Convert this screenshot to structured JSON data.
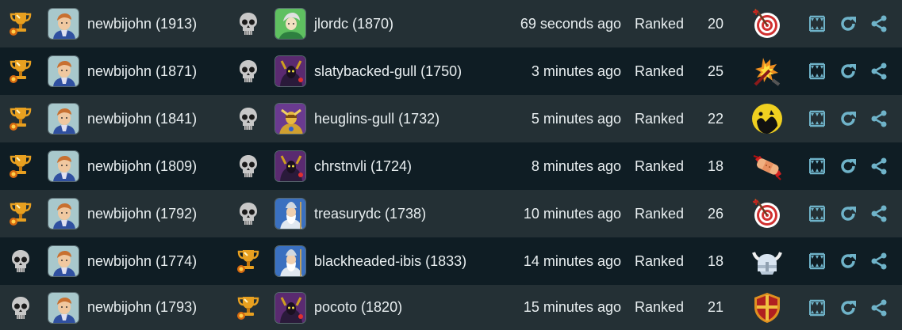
{
  "colors": {
    "row_odd": "#243035",
    "row_even": "#0f1d24",
    "text": "#e8eef0",
    "action_icon": "#6fb3c9",
    "trophy": "#e8a020",
    "skull": "#c8c8c8"
  },
  "games": [
    {
      "p1_result": "trophy-icon",
      "p1_name": "newbijohn (1913)",
      "p1_avatar": "portrait-avatar",
      "p2_result": "skull-icon",
      "p2_name": "jlordc (1870)",
      "p2_avatar": "green-elf-avatar",
      "time": "69 seconds ago",
      "mode": "Ranked",
      "turns": "20",
      "map_icon": "target-icon"
    },
    {
      "p1_result": "trophy-icon",
      "p1_name": "newbijohn (1871)",
      "p1_avatar": "portrait-avatar",
      "p2_result": "skull-icon",
      "p2_name": "slatybacked-gull (1750)",
      "p2_avatar": "dark-mage-avatar",
      "time": "3 minutes ago",
      "mode": "Ranked",
      "turns": "25",
      "map_icon": "explosion-icon"
    },
    {
      "p1_result": "trophy-icon",
      "p1_name": "newbijohn (1841)",
      "p1_avatar": "portrait-avatar",
      "p2_result": "skull-icon",
      "p2_name": "heuglins-gull (1732)",
      "p2_avatar": "golden-knight-avatar",
      "time": "5 minutes ago",
      "mode": "Ranked",
      "turns": "22",
      "map_icon": "moon-battle-icon"
    },
    {
      "p1_result": "trophy-icon",
      "p1_name": "newbijohn (1809)",
      "p1_avatar": "portrait-avatar",
      "p2_result": "skull-icon",
      "p2_name": "chrstnvli (1724)",
      "p2_avatar": "dark-mage-avatar",
      "time": "8 minutes ago",
      "mode": "Ranked",
      "turns": "18",
      "map_icon": "bandage-icon"
    },
    {
      "p1_result": "trophy-icon",
      "p1_name": "newbijohn (1792)",
      "p1_avatar": "portrait-avatar",
      "p2_result": "skull-icon",
      "p2_name": "treasurydc (1738)",
      "p2_avatar": "wizard-avatar",
      "time": "10 minutes ago",
      "mode": "Ranked",
      "turns": "26",
      "map_icon": "target-icon"
    },
    {
      "p1_result": "skull-icon",
      "p1_name": "newbijohn (1774)",
      "p1_avatar": "portrait-avatar",
      "p2_result": "trophy-icon",
      "p2_name": "blackheaded-ibis (1833)",
      "p2_avatar": "wizard-avatar",
      "time": "14 minutes ago",
      "mode": "Ranked",
      "turns": "18",
      "map_icon": "viking-helmet-icon"
    },
    {
      "p1_result": "skull-icon",
      "p1_name": "newbijohn (1793)",
      "p1_avatar": "portrait-avatar",
      "p2_result": "trophy-icon",
      "p2_name": "pocoto (1820)",
      "p2_avatar": "dark-mage-avatar",
      "time": "15 minutes ago",
      "mode": "Ranked",
      "turns": "21",
      "map_icon": "shield-icon"
    }
  ],
  "actions": {
    "replay_icon": "replay-teeth-icon",
    "rematch_icon": "refresh-icon",
    "share_icon": "share-icon"
  }
}
